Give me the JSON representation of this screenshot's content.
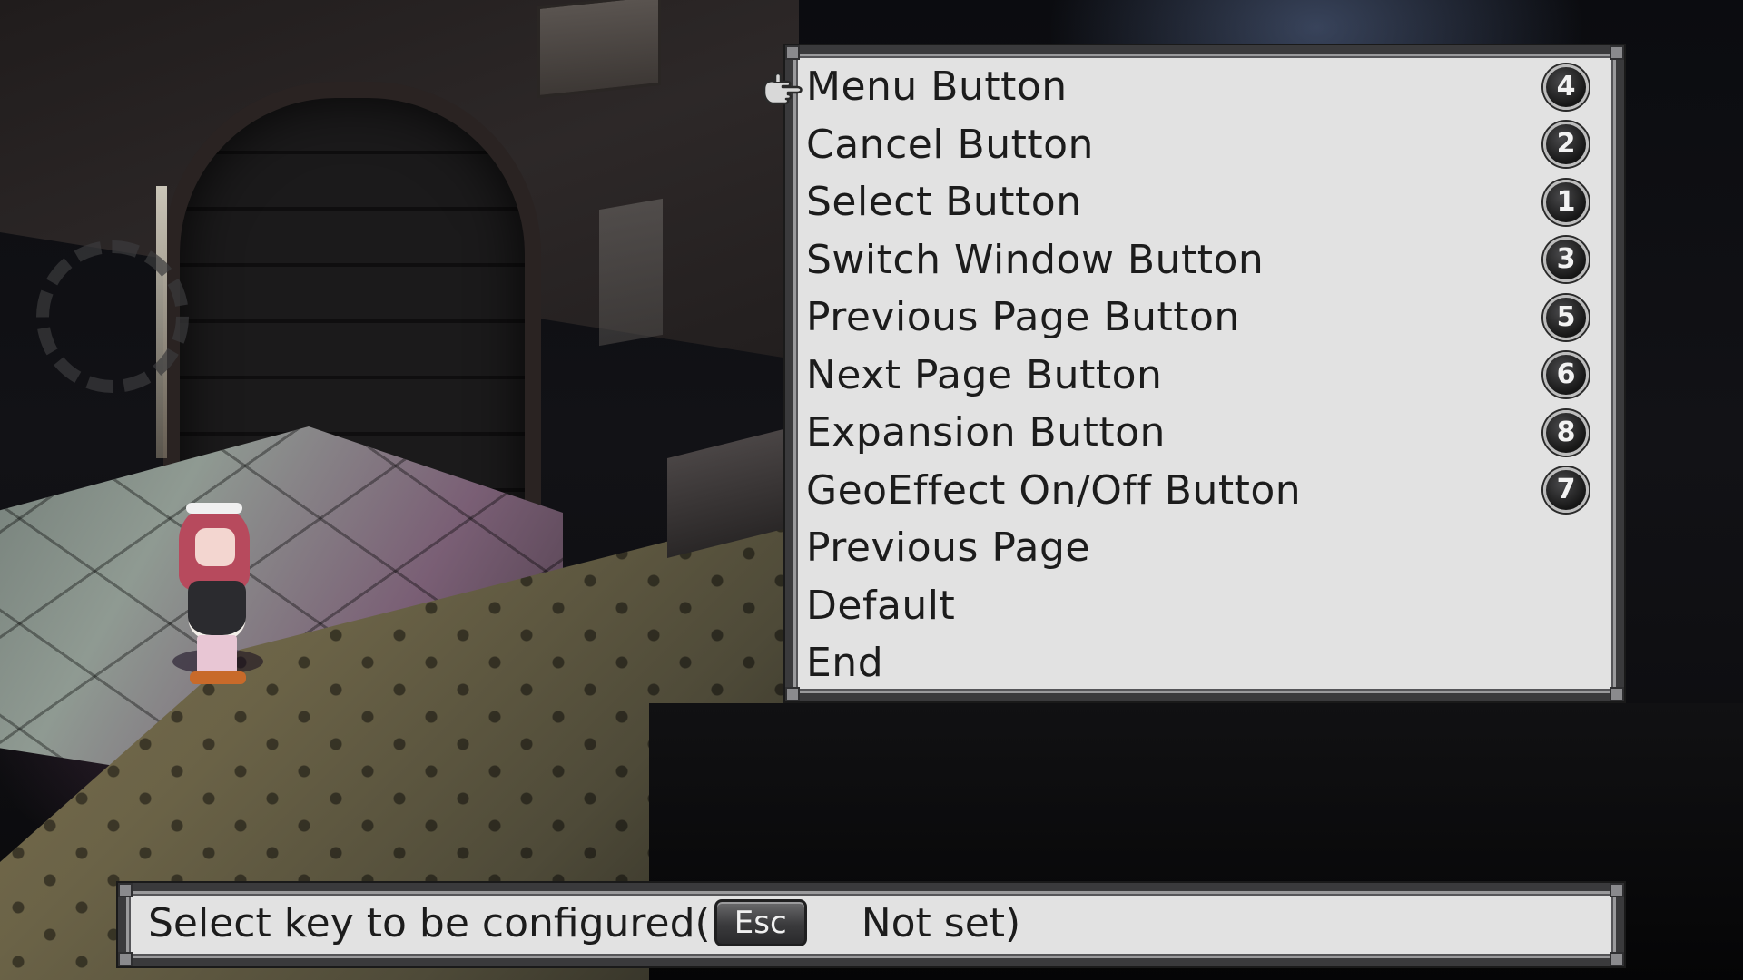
{
  "menu": {
    "items": [
      {
        "label": "Menu Button",
        "key": "4"
      },
      {
        "label": "Cancel Button",
        "key": "2"
      },
      {
        "label": "Select Button",
        "key": "1"
      },
      {
        "label": "Switch Window Button",
        "key": "3"
      },
      {
        "label": "Previous Page Button",
        "key": "5"
      },
      {
        "label": "Next Page Button",
        "key": "6"
      },
      {
        "label": "Expansion Button",
        "key": "8"
      },
      {
        "label": "GeoEffect On/Off Button",
        "key": "7"
      },
      {
        "label": "Previous Page",
        "key": null
      },
      {
        "label": "Default",
        "key": null
      },
      {
        "label": "End",
        "key": null
      }
    ],
    "selected_index": 0
  },
  "status": {
    "prompt": "Select key to be configured(",
    "esc_label": "Esc",
    "not_set": "Not set)"
  },
  "colors": {
    "panel_bg": "#e2e2e2",
    "panel_border": "#3a3a3c",
    "text": "#1c1c1c",
    "badge_bg": "#1e1e1e"
  },
  "icons": {
    "cursor": "pointing-hand-icon"
  }
}
